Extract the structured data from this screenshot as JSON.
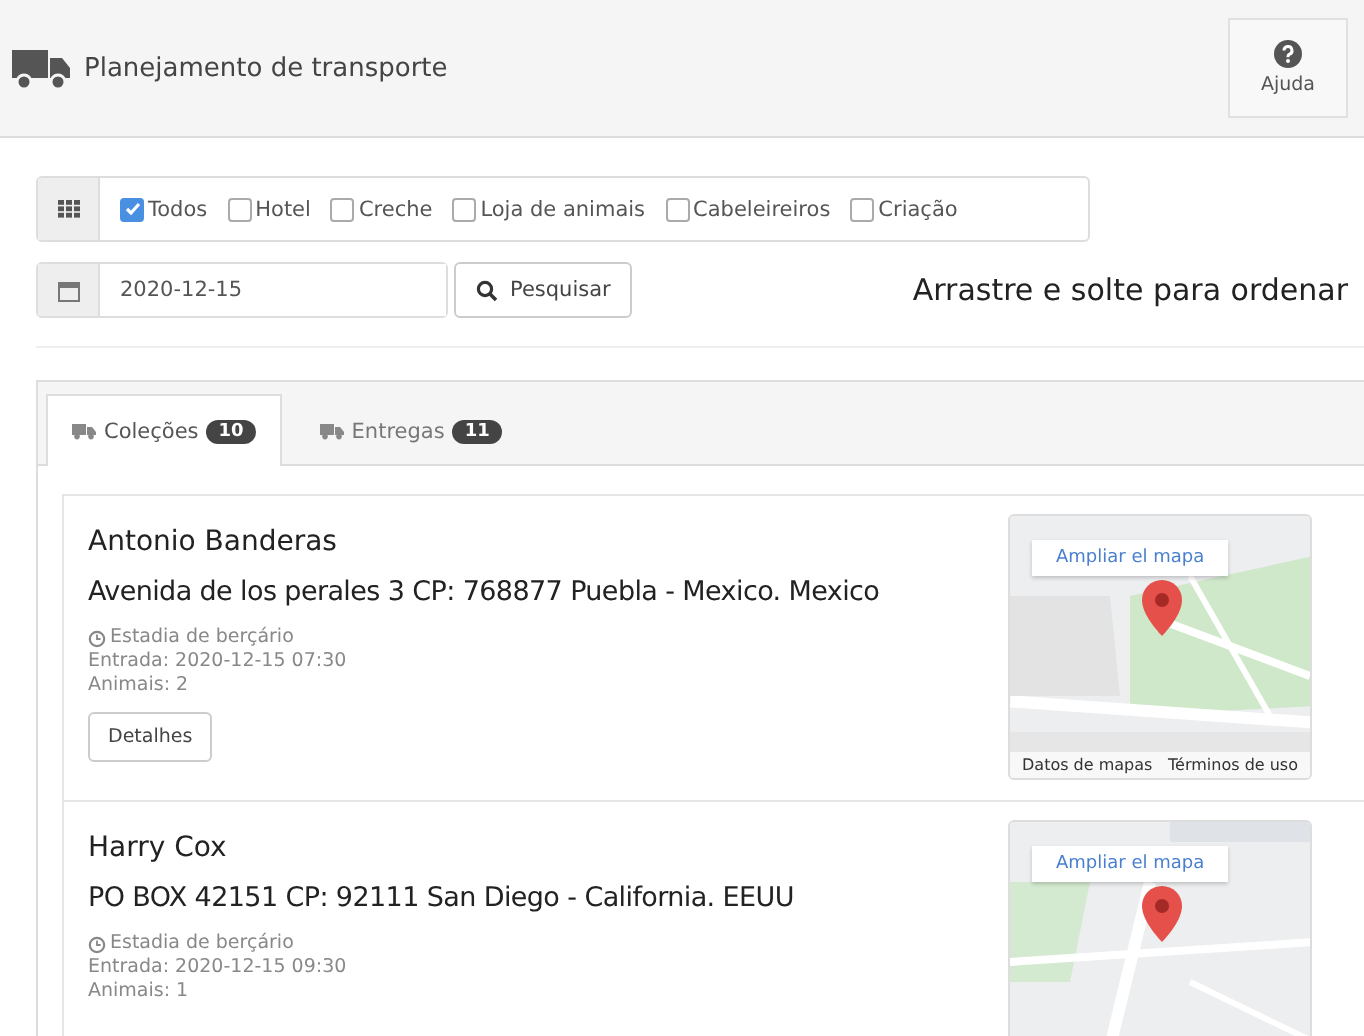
{
  "header": {
    "title": "Planejamento de transporte",
    "help_button": "Ajuda"
  },
  "filters": [
    {
      "label": "Todos",
      "checked": true
    },
    {
      "label": "Hotel",
      "checked": false
    },
    {
      "label": "Creche",
      "checked": false
    },
    {
      "label": "Loja de animais",
      "checked": false
    },
    {
      "label": "Cabeleireiros",
      "checked": false
    },
    {
      "label": "Criação",
      "checked": false
    }
  ],
  "date_field": {
    "value": "2020-12-15"
  },
  "search_button": "Pesquisar",
  "hint": "Arrastre e solte para ordenar",
  "tabs": [
    {
      "label": "Coleções",
      "count": "10",
      "selected": true
    },
    {
      "label": "Entregas",
      "count": "11",
      "selected": false
    }
  ],
  "items": [
    {
      "name": "Antonio Banderas",
      "address": "Avenida de los perales 3 CP: 768877 Puebla - Mexico. Mexico",
      "service": "Estadia de berçário",
      "entry": "Entrada: 2020-12-15 07:30",
      "animals": "Animais: 2",
      "details_button": "Detalhes",
      "map": {
        "enlarge": "Ampliar el mapa",
        "attribution": [
          "Datos de mapas",
          "Términos de uso"
        ]
      }
    },
    {
      "name": "Harry Cox",
      "address": "PO BOX 42151 CP: 92111 San Diego - California. EEUU",
      "service": "Estadia de berçário",
      "entry": "Entrada: 2020-12-15 09:30",
      "animals": "Animais: 1",
      "map": {
        "enlarge": "Ampliar el mapa"
      }
    }
  ]
}
